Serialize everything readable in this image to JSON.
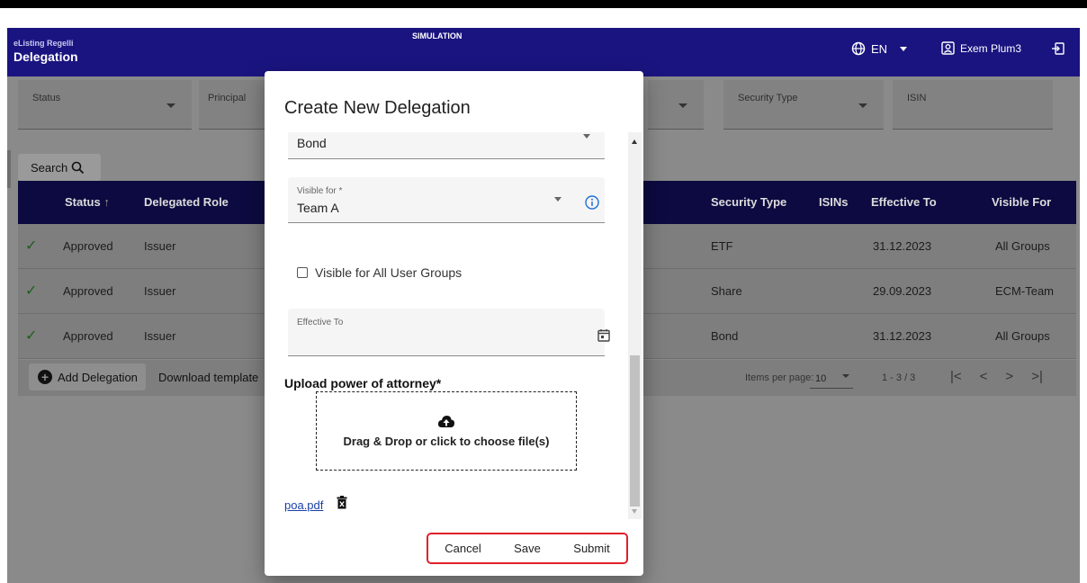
{
  "header": {
    "brand_sub": "eListing Regelli",
    "title": "Delegation",
    "environment": "SIMULATION",
    "language": "EN",
    "user": "Exem Plum3"
  },
  "filters": [
    {
      "label": "Status"
    },
    {
      "label": "Principal"
    },
    {
      "label": ""
    },
    {
      "label": "Security Type"
    },
    {
      "label": "ISIN"
    }
  ],
  "search_label": "Search",
  "table": {
    "columns": [
      "Status",
      "Delegated Role",
      "Security Type",
      "ISINs",
      "Effective To",
      "Visible For"
    ],
    "rows": [
      {
        "status": "Approved",
        "role": "Issuer",
        "security_type": "ETF",
        "isins": "",
        "effective_to": "31.12.2023",
        "visible_for": "All Groups"
      },
      {
        "status": "Approved",
        "role": "Issuer",
        "security_type": "Share",
        "isins": "",
        "effective_to": "29.09.2023",
        "visible_for": "ECM-Team"
      },
      {
        "status": "Approved",
        "role": "Issuer",
        "security_type": "Bond",
        "isins": "",
        "effective_to": "31.12.2023",
        "visible_for": "All Groups"
      }
    ]
  },
  "footer": {
    "add_label": "Add Delegation",
    "download_label": "Download template",
    "items_per_page_label": "Items per page:",
    "items_per_page_value": "10",
    "range": "1 - 3 / 3"
  },
  "dialog": {
    "title": "Create New Delegation",
    "security_type_value": "Bond",
    "visible_for_label": "Visible for *",
    "visible_for_value": "Team A",
    "visible_all_label": "Visible for All User Groups",
    "effective_to_label": "Effective To",
    "upload_title": "Upload power of attorney*",
    "dropzone_text": "Drag & Drop or click to choose file(s)",
    "file_name": "poa.pdf",
    "cancel_label": "Cancel",
    "save_label": "Save",
    "submit_label": "Submit"
  },
  "colors": {
    "header_bg": "#1a1480",
    "table_header_bg": "#0c0a40",
    "highlight_border": "#e0202a",
    "link": "#1a3fa8",
    "info_icon": "#1e6fd9"
  }
}
